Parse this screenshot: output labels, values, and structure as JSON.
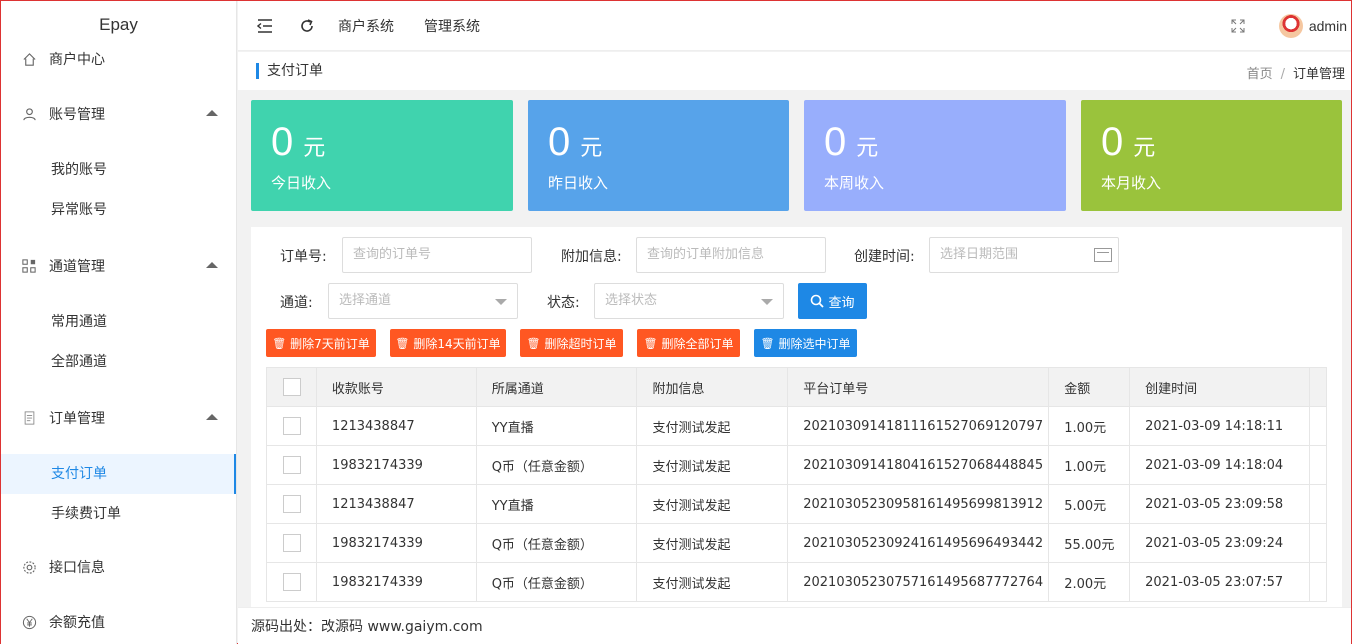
{
  "brand": "Epay",
  "sidebar": {
    "merchant_center": "商户中心",
    "account_mgmt": "账号管理",
    "my_account": "我的账号",
    "abnormal_account": "异常账号",
    "channel_mgmt": "通道管理",
    "common_channel": "常用通道",
    "all_channel": "全部通道",
    "order_mgmt": "订单管理",
    "pay_order": "支付订单",
    "fee_order": "手续费订单",
    "api_info": "接口信息",
    "recharge": "余额充值"
  },
  "topbar": {
    "menu_merchant": "商户系统",
    "menu_admin": "管理系统",
    "user": "admin"
  },
  "breadcrumb": {
    "title": "支付订单",
    "home": "首页",
    "sep": "/",
    "current": "订单管理"
  },
  "colors": {
    "card_today": "#40d3ae",
    "card_yesterday": "#57a3ea",
    "card_week": "#98aefc",
    "card_month": "#9ac33c",
    "primary": "#1e88e5",
    "danger": "#ff5722"
  },
  "cards": [
    {
      "num": "0",
      "unit": "元",
      "label": "今日收入"
    },
    {
      "num": "0",
      "unit": "元",
      "label": "昨日收入"
    },
    {
      "num": "0",
      "unit": "元",
      "label": "本周收入"
    },
    {
      "num": "0",
      "unit": "元",
      "label": "本月收入"
    }
  ],
  "filters": {
    "order_no_label": "订单号:",
    "order_no_placeholder": "查询的订单号",
    "extra_label": "附加信息:",
    "extra_placeholder": "查询的订单附加信息",
    "time_label": "创建时间:",
    "time_placeholder": "选择日期范围",
    "channel_label": "通道:",
    "channel_placeholder": "选择通道",
    "status_label": "状态:",
    "status_placeholder": "选择状态",
    "query": "查询"
  },
  "actions": {
    "del7": "删除7天前订单",
    "del14": "删除14天前订单",
    "del_timeout": "删除超时订单",
    "del_all": "删除全部订单",
    "del_selected": "删除选中订单"
  },
  "table": {
    "headers": [
      "收款账号",
      "所属通道",
      "附加信息",
      "平台订单号",
      "金额",
      "创建时间"
    ],
    "rows": [
      [
        "1213438847",
        "YY直播",
        "支付测试发起",
        "20210309141811161527069120797",
        "1.00元",
        "2021-03-09 14:18:11"
      ],
      [
        "19832174339",
        "Q币（任意金额）",
        "支付测试发起",
        "20210309141804161527068448845",
        "1.00元",
        "2021-03-09 14:18:04"
      ],
      [
        "1213438847",
        "YY直播",
        "支付测试发起",
        "20210305230958161495699813912",
        "5.00元",
        "2021-03-05 23:09:58"
      ],
      [
        "19832174339",
        "Q币（任意金额）",
        "支付测试发起",
        "20210305230924161495696493442",
        "55.00元",
        "2021-03-05 23:09:24"
      ],
      [
        "19832174339",
        "Q币（任意金额）",
        "支付测试发起",
        "20210305230757161495687772764",
        "2.00元",
        "2021-03-05 23:07:57"
      ]
    ]
  },
  "footer": "源码出处：改源码 www.gaiym.com"
}
